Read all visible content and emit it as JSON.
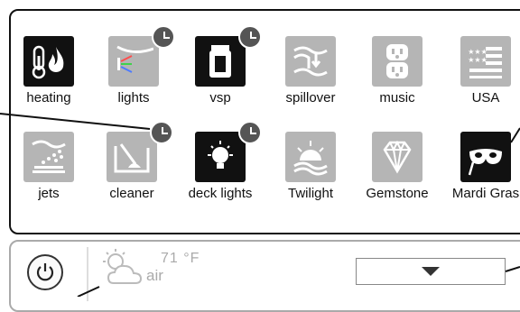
{
  "tiles": [
    {
      "label": "heating",
      "icon": "thermometer-flame-icon"
    },
    {
      "label": "lights",
      "icon": "light-beam-icon"
    },
    {
      "label": "vsp",
      "icon": "pump-icon"
    },
    {
      "label": "spillover",
      "icon": "spillover-icon"
    },
    {
      "label": "music",
      "icon": "outlet-icon"
    },
    {
      "label": "USA",
      "icon": "flag-icon"
    },
    {
      "label": "jets",
      "icon": "jets-icon"
    },
    {
      "label": "cleaner",
      "icon": "pool-cleaner-icon"
    },
    {
      "label": "deck lights",
      "icon": "bulb-icon"
    },
    {
      "label": "Twilight",
      "icon": "sunset-icon"
    },
    {
      "label": "Gemstone",
      "icon": "diamond-icon"
    },
    {
      "label": "Mardi Gras",
      "icon": "mask-icon"
    }
  ],
  "weather": {
    "temp": "71 °F",
    "label": "air",
    "icon": "partly-cloudy-icon"
  },
  "power": {
    "icon": "power-icon"
  },
  "dropdown": {
    "icon": "triangle-down-icon"
  },
  "colors": {
    "dark_tile": "#111111",
    "grey_tile": "#b5b5b5",
    "clock_badge": "#555555"
  }
}
